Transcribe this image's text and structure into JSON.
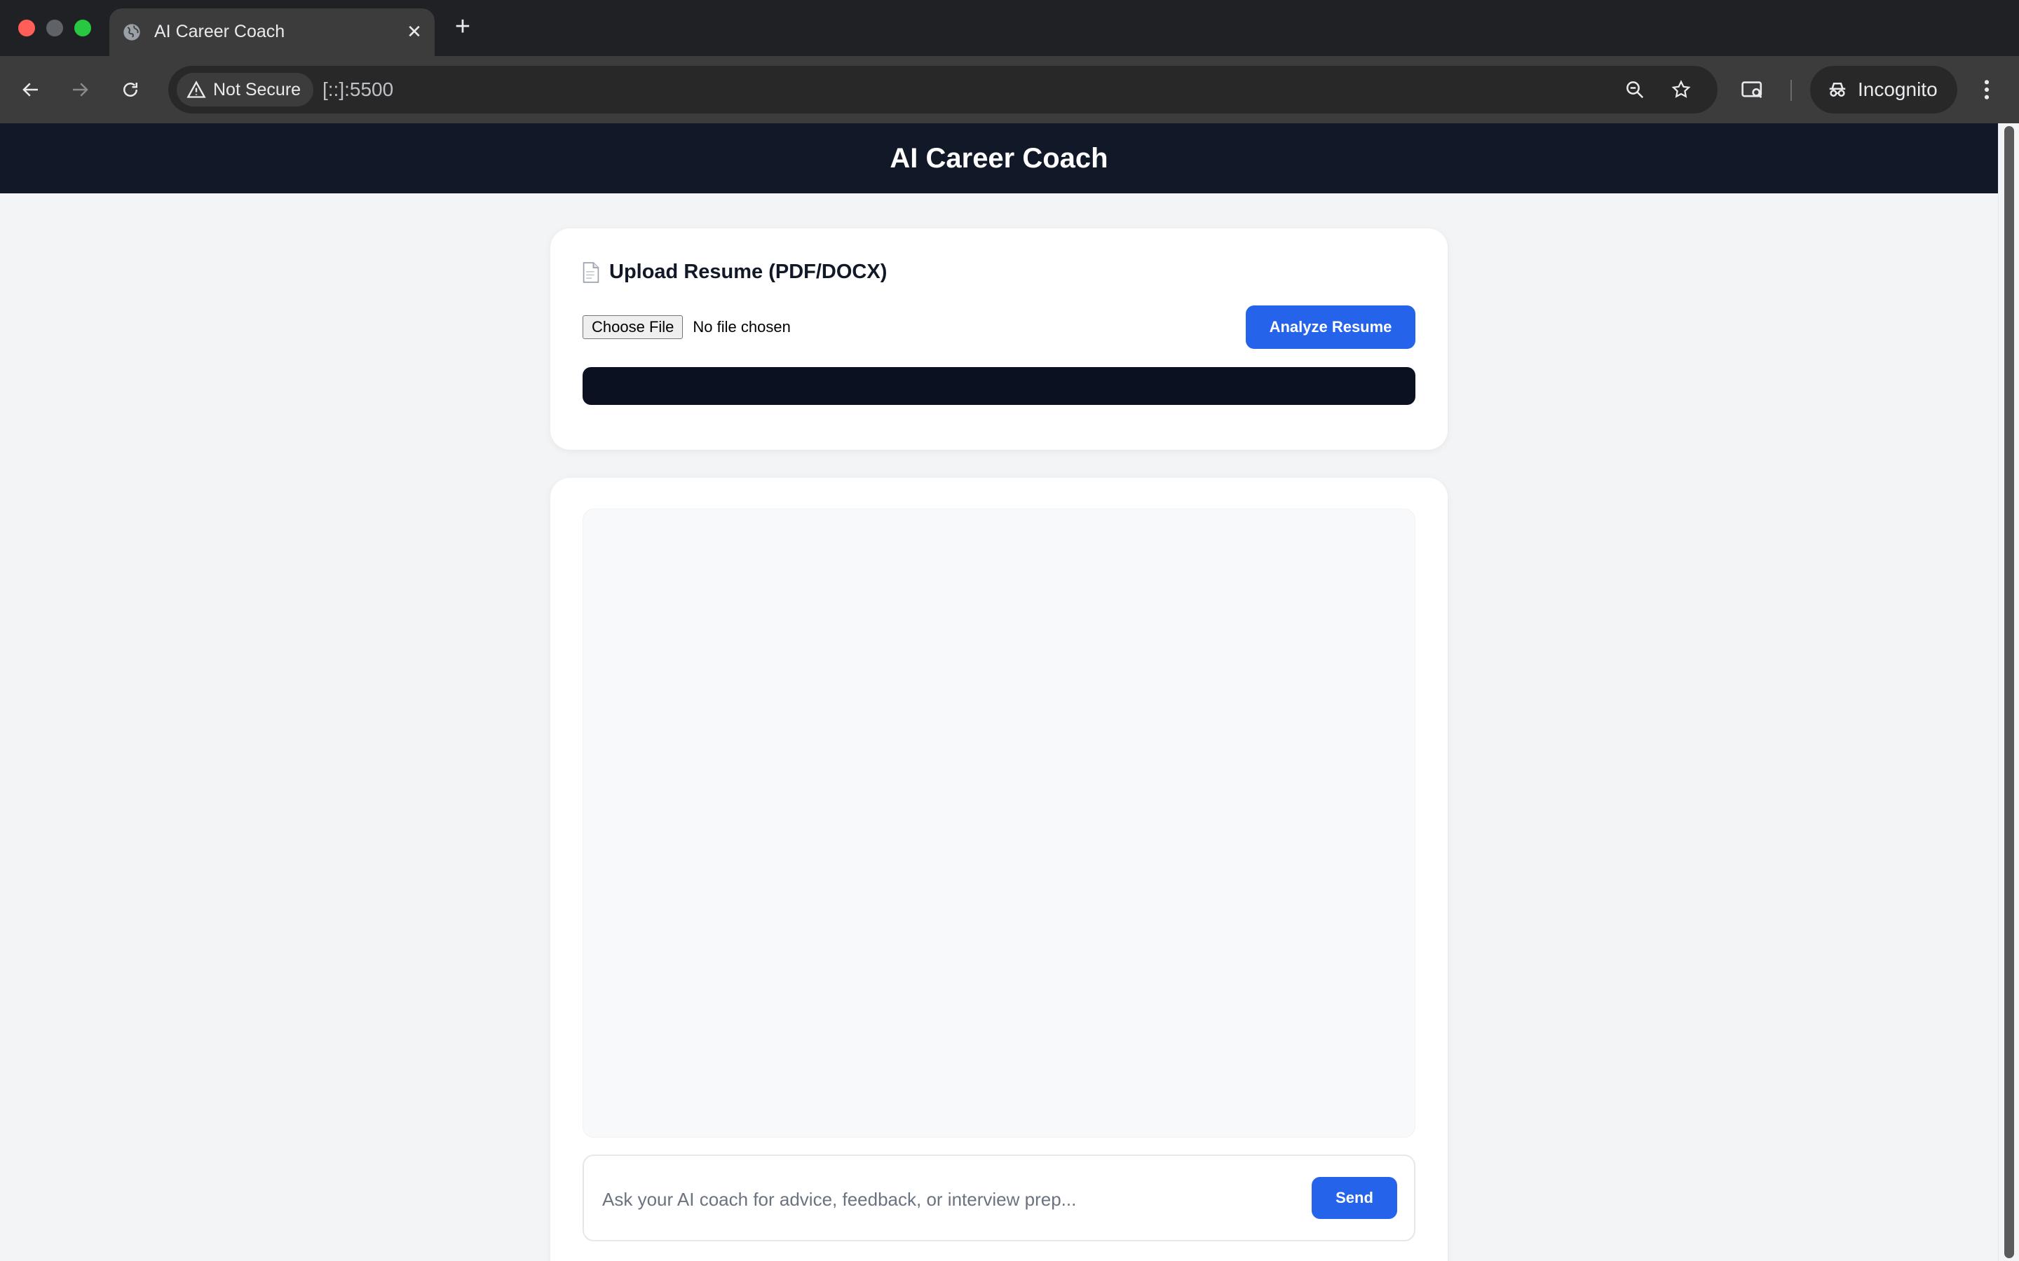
{
  "browser": {
    "tab_title": "AI Career Coach",
    "security_label": "Not Secure",
    "url": "[::]:5500",
    "profile_label": "Incognito"
  },
  "app": {
    "title": "AI Career Coach"
  },
  "upload": {
    "title": "Upload Resume (PDF/DOCX)",
    "choose_file_label": "Choose File",
    "file_status": "No file chosen",
    "analyze_label": "Analyze Resume"
  },
  "chat": {
    "placeholder": "Ask your AI coach for advice, feedback, or interview prep...",
    "send_label": "Send"
  },
  "colors": {
    "header_bg": "#111827",
    "accent": "#2563eb",
    "page_bg": "#f3f4f6"
  }
}
